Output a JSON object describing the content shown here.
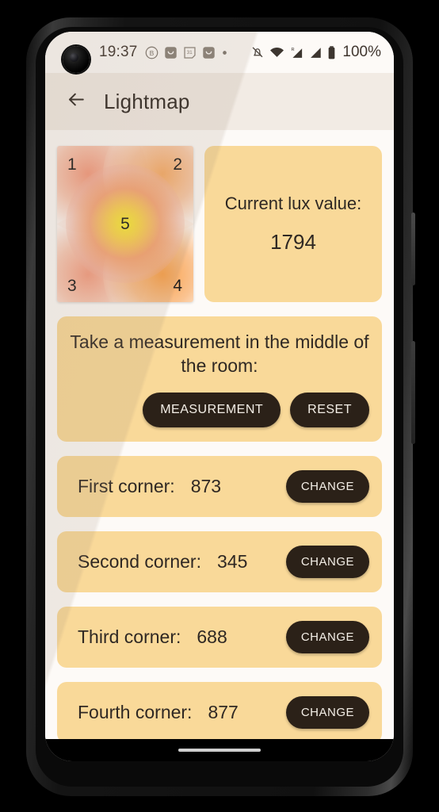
{
  "status_bar": {
    "time": "19:37",
    "battery_percent": "100%",
    "left_icons": [
      "b-circle-icon",
      "messaging-bag-icon",
      "calendar-31-icon",
      "messaging-bag-icon",
      "dot-icon"
    ],
    "right_icons": [
      "notifications-off-icon",
      "wifi-icon",
      "roaming-signal-icon",
      "signal-icon",
      "battery-icon"
    ],
    "calendar_day": "31",
    "roaming_marker": "R"
  },
  "appbar": {
    "back_icon": "arrow-left-icon",
    "title": "Lightmap"
  },
  "heatmap": {
    "points": [
      {
        "label": "1",
        "x_pct": 12,
        "y_pct": 10,
        "intensity": 873
      },
      {
        "label": "2",
        "x_pct": 88,
        "y_pct": 10,
        "intensity": 345
      },
      {
        "label": "3",
        "x_pct": 12,
        "y_pct": 90,
        "intensity": 688
      },
      {
        "label": "4",
        "x_pct": 88,
        "y_pct": 90,
        "intensity": 877
      },
      {
        "label": "5",
        "x_pct": 50,
        "y_pct": 50,
        "intensity": 1794
      }
    ]
  },
  "lux_card": {
    "label": "Current lux value:",
    "value": "1794"
  },
  "measurement_card": {
    "instruction": "Take a measurement in the middle of the room:",
    "measurement_button": "MEASUREMENT",
    "reset_button": "RESET"
  },
  "corners": [
    {
      "label": "First corner:",
      "value": "873",
      "button": "CHANGE"
    },
    {
      "label": "Second corner:",
      "value": "345",
      "button": "CHANGE"
    },
    {
      "label": "Third corner:",
      "value": "688",
      "button": "CHANGE"
    },
    {
      "label": "Fourth corner:",
      "value": "877",
      "button": "CHANGE"
    }
  ],
  "colors": {
    "card": "#F9D999",
    "page_background": "#FDFAF7",
    "appbar_background": "#F2EBE4",
    "button": "#2B2118",
    "button_text": "#F4EFE7",
    "text": "#2F2823"
  },
  "nav": {
    "gesture_bar": "gesture-bar"
  }
}
